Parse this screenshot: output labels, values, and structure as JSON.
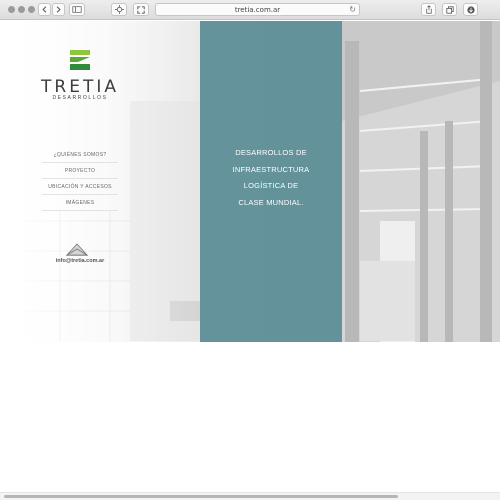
{
  "browser": {
    "url": "tretia.com.ar",
    "icons": [
      "back-icon",
      "forward-icon",
      "sidebar-icon",
      "extension-icon",
      "fullscreen-icon",
      "reload-icon",
      "share-icon",
      "tabs-icon",
      "download-icon"
    ]
  },
  "logo": {
    "word": "TRETIA",
    "sub": "DESARROLLOS",
    "colors": {
      "green_light": "#8ec63f",
      "green_dark": "#2f8c3a"
    }
  },
  "nav": {
    "items": [
      {
        "label": "¿QUIÉNES SOMOS?"
      },
      {
        "label": "PROYECTO"
      },
      {
        "label": "UBICACIÓN Y ACCESOS"
      },
      {
        "label": "IMÁGENES"
      }
    ]
  },
  "contact": {
    "email": "info@tretia.com.ar"
  },
  "hero": {
    "lines": [
      "DESARROLLOS DE",
      "INFRAESTRUCTURA",
      "LOGÍSTICA DE",
      "CLASE MUNDIAL."
    ],
    "panel_color": "#5f8f98"
  }
}
